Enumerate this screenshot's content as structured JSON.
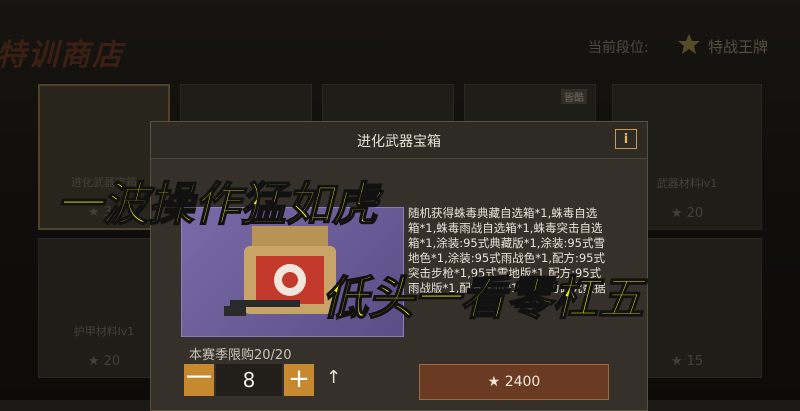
{
  "shop": {
    "title": "特训商店",
    "rank_label": "当前段位:",
    "rank_value": "特战王牌"
  },
  "cards": [
    {
      "name": "进化武器宝箱",
      "price": "30"
    },
    {
      "name": "",
      "price": ""
    },
    {
      "name": "",
      "price": ""
    },
    {
      "name": "",
      "price": "",
      "tag": "皆酷"
    },
    {
      "name": "武器材料lv1",
      "price": "20"
    },
    {
      "name": "护甲材料lv1",
      "price": "20"
    },
    {
      "name": "",
      "price": "15"
    }
  ],
  "dialog": {
    "title": "进化武器宝箱",
    "info_icon": "i",
    "desc": "随机获得蛛毒典藏自选箱*1,蛛毒自选箱*1,蛛毒雨战自选箱*1,蛛毒突击自选箱*1,涂装:95式典藏版*1,涂装:95式雪地色*1,涂装:95式雨战色*1,配方:95式突击步枪*1,95式雪地版*1,配方:95式雨战版*1,配方残页*150,能力研究数据",
    "limit": "本赛季限购20/20",
    "quantity": "8",
    "minus": "一",
    "plus": "+",
    "max_symbol": "↑",
    "price_star": "★",
    "price": "2400"
  },
  "captions": {
    "line1": "一波操作猛如虎",
    "line2": "低头一看零杠五"
  },
  "colors": {
    "accent": "#c7892f",
    "caption": "#f5f010",
    "buy_button": "#6a3b22"
  }
}
